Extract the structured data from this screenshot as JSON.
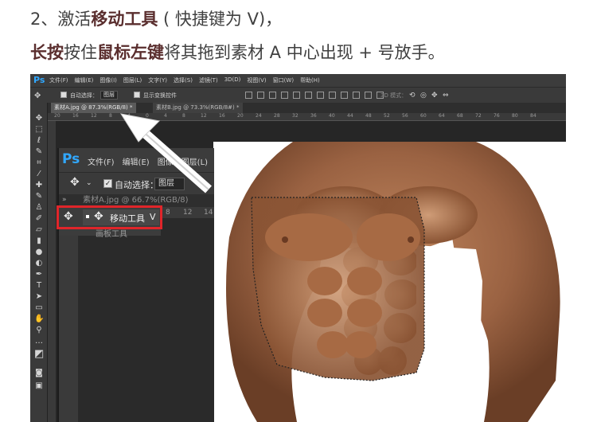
{
  "instructions": {
    "step_prefix": "2、激活",
    "step_emphasis": "移动工具",
    "step_suffix": " ( 快捷键为 V)，",
    "desc_emph1": "长按",
    "desc_mid1": "按住",
    "desc_emph2": "鼠标左键",
    "desc_mid2": "将其拖到素材 A 中心出现 + 号放手。"
  },
  "ps_main": {
    "logo": "Ps",
    "menu": [
      "文件(F)",
      "编辑(E)",
      "图像(I)",
      "图层(L)",
      "文字(Y)",
      "选择(S)",
      "滤镜(T)",
      "3D(D)",
      "视图(V)",
      "窗口(W)",
      "帮助(H)"
    ],
    "options": {
      "auto_select": "自动选择：",
      "layer_select": "图层",
      "show_transform": "显示变换控件",
      "mode3d": "3D 模式："
    },
    "tabs": [
      "素材A.jpg @ 87.3%(RGB/8) *",
      "素材B.jpg @ 73.3%(RGB/8#) *"
    ],
    "ruler": [
      "20",
      "16",
      "12",
      "8",
      "4",
      "0",
      "4",
      "8",
      "12",
      "16",
      "20",
      "24",
      "28",
      "32",
      "36",
      "40",
      "44",
      "48",
      "52",
      "56",
      "60",
      "64",
      "68",
      "72",
      "76",
      "80",
      "84"
    ]
  },
  "ps_zoom": {
    "logo": "Ps",
    "menu": [
      "文件(F)",
      "编辑(E)",
      "图像",
      "图层(L)"
    ],
    "options": {
      "auto_select": "自动选择：",
      "layer_select": "图层"
    },
    "tab": "素材A.jpg @ 66.7%(RGB/8)",
    "ruler": [
      "8",
      "4",
      "0",
      "4",
      "8",
      "12",
      "14"
    ],
    "popup": {
      "tool_label": "移动工具",
      "shortcut": "V",
      "second_tool": "画板工具"
    }
  },
  "colors": {
    "ps_blue": "#31a8ff",
    "highlight_red": "#e0252a",
    "title_emph": "#5a2e2e"
  }
}
